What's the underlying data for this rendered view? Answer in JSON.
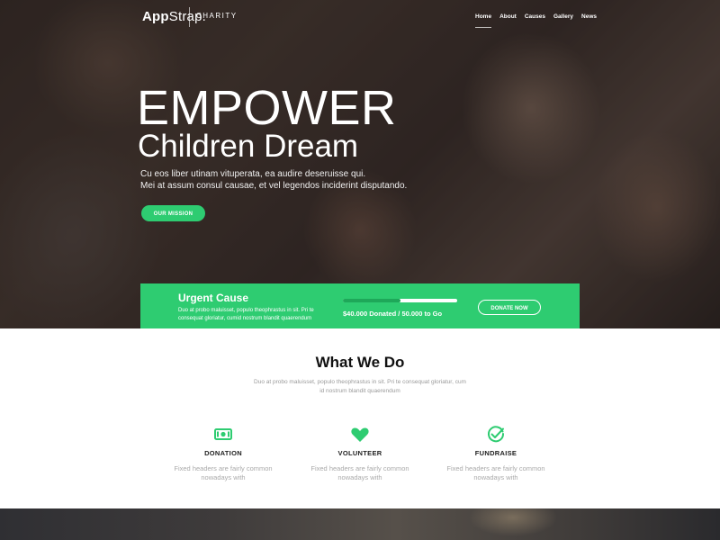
{
  "brand": {
    "name_bold": "App",
    "name_rest": "Strap.",
    "tagline": "CHARITY"
  },
  "nav": {
    "items": [
      "Home",
      "About",
      "Causes",
      "Gallery",
      "News"
    ],
    "active": "Home"
  },
  "hero": {
    "title": "EMPOWER",
    "subtitle": "Children Dream",
    "desc_line1": "Cu eos liber utinam vituperata, ea audire deseruisse qui.",
    "desc_line2": "Mei at assum consul causae, et vel legendos inciderint disputando.",
    "button": "OUR MISSION"
  },
  "urgent": {
    "title": "Urgent Cause",
    "text_line1": "Duo at probo maluisset, populo theophrastus in sit. Pri te",
    "text_line2": "consequat gloriatur, cumid nostrum blandit quaerendum",
    "progress_fraction": 0.5,
    "progress_text": "$40.000 Donated / 50.000 to Go",
    "button": "DONATE NOW"
  },
  "what_we_do": {
    "title": "What We Do",
    "desc_line1": "Duo at probo maluisset, populo theophrastus in sit. Pri te consequat gloriatur, cum",
    "desc_line2": "id nostrum blandit quaerendum",
    "features": [
      {
        "icon": "money-icon",
        "title": "DONATION",
        "line1": "Fixed headers are fairly common",
        "line2": "nowadays with"
      },
      {
        "icon": "heart-icon",
        "title": "VOLUNTEER",
        "line1": "Fixed headers are fairly common",
        "line2": "nowadays with"
      },
      {
        "icon": "check-circle-icon",
        "title": "FUNDRAISE",
        "line1": "Fixed headers are fairly common",
        "line2": "nowadays with"
      }
    ]
  },
  "colors": {
    "accent": "#2ecc71",
    "heading": "#111111",
    "muted": "#9a9a9a"
  }
}
